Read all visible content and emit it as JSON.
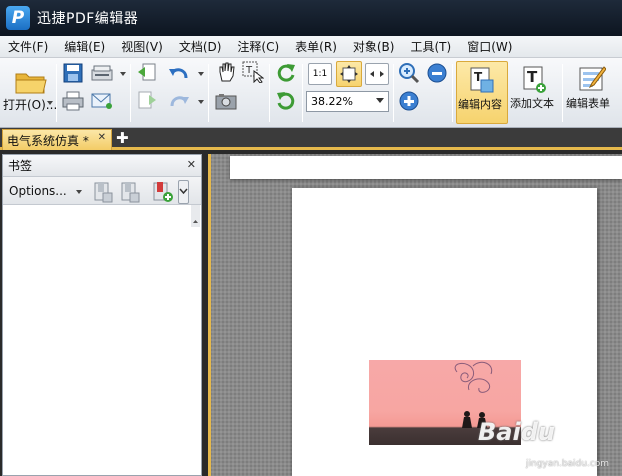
{
  "app": {
    "title": "迅捷PDF编辑器",
    "logo_letter": "P"
  },
  "menu": [
    "文件(F)",
    "编辑(E)",
    "视图(V)",
    "文档(D)",
    "注释(C)",
    "表单(R)",
    "对象(B)",
    "工具(T)",
    "窗口(W)"
  ],
  "toolbar": {
    "open_label": "打开(O)...",
    "zoom_value": "38.22%",
    "edit_content_label": "编辑内容",
    "add_text_label": "添加文本",
    "edit_form_label": "编辑表单",
    "actual_size_glyph": "1:1"
  },
  "tabs": [
    {
      "label": "电气系统仿真 *"
    }
  ],
  "bookmark_panel": {
    "title": "书签",
    "options_label": "Options..."
  },
  "watermark": {
    "brand": "Baidu",
    "sub": "jingyan.baidu.com"
  },
  "colors": {
    "accent": "#e6b94c",
    "active_button": "#f6d36e",
    "titlebar": "#0d1520"
  }
}
